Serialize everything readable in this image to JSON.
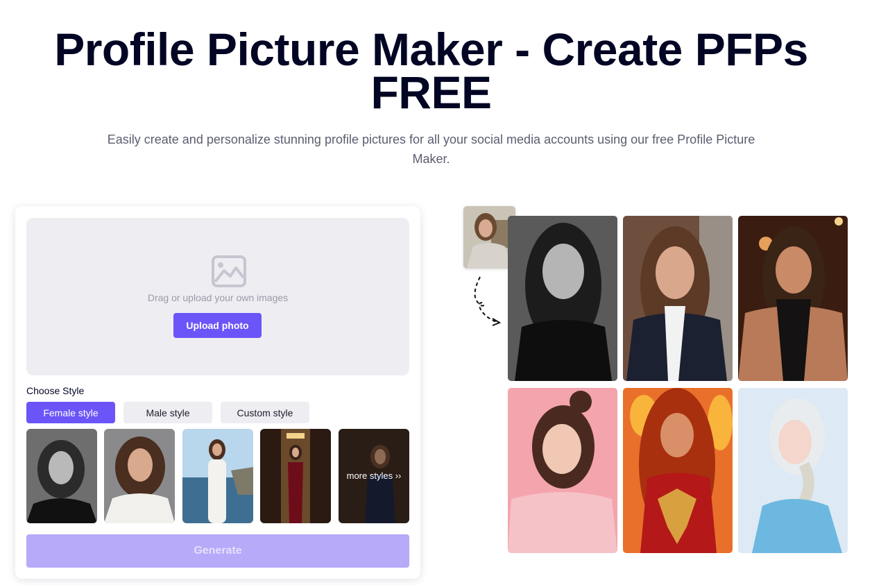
{
  "hero": {
    "title": "Profile Picture Maker - Create PFPs FREE",
    "subtitle": "Easily create and personalize stunning profile pictures for all your social media accounts using our free Profile Picture Maker."
  },
  "uploader": {
    "icon": "image-placeholder-icon",
    "drop_text": "Drag or upload your own images",
    "upload_button": "Upload photo"
  },
  "style_picker": {
    "label": "Choose Style",
    "tabs": [
      {
        "label": "Female style",
        "active": true
      },
      {
        "label": "Male style",
        "active": false
      },
      {
        "label": "Custom style",
        "active": false
      }
    ],
    "thumbnails": [
      {
        "name": "black-and-white-portrait"
      },
      {
        "name": "white-blazer-portrait"
      },
      {
        "name": "yacht-white-outfit"
      },
      {
        "name": "red-velvet-gown"
      },
      {
        "name": "more-styles",
        "label": "more styles ››"
      }
    ]
  },
  "generate_button": "Generate",
  "showcase": {
    "source": "original-photo",
    "results": [
      "black-white-turtleneck",
      "business-suit",
      "black-halter-dress",
      "pink-gingham-shirt",
      "fire-phoenix-costume",
      "ice-princess-costume"
    ]
  },
  "colors": {
    "accent": "#6b55f9",
    "accent_disabled": "#b6aaf9",
    "title": "#020523",
    "dropzone_bg": "#eeedf2"
  }
}
